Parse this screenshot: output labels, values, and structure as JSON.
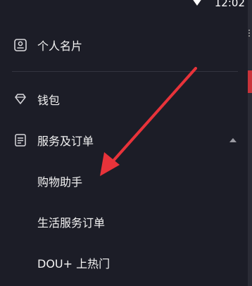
{
  "status_bar": {
    "time": "12:02"
  },
  "menu": {
    "profile_card": "个人名片",
    "wallet": "钱包",
    "services_orders": "服务及订单",
    "shopping_assistant": "购物助手",
    "life_service_orders": "生活服务订单",
    "dou_plus": "DOU+ 上热门"
  },
  "icons": {
    "profile_card": "person-card-icon",
    "wallet": "diamond-icon",
    "services_orders": "document-icon",
    "expand": "caret-up-icon"
  },
  "colors": {
    "background": "#1c1d27",
    "text": "#f2f2f2",
    "arrow": "#e8333a"
  }
}
